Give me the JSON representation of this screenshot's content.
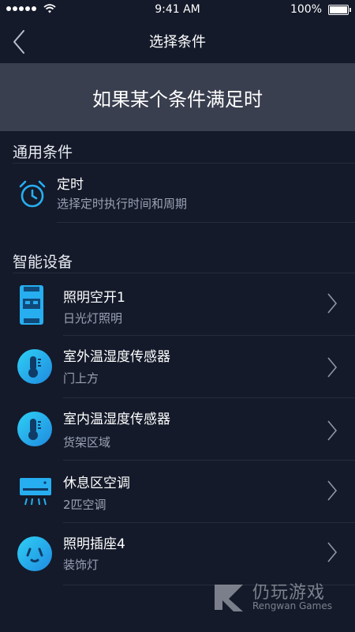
{
  "status": {
    "time": "9:41 AM",
    "battery": "100%"
  },
  "nav": {
    "title": "选择条件"
  },
  "banner": {
    "text": "如果某个条件满足时"
  },
  "general": {
    "title": "通用条件",
    "item": {
      "title": "定时",
      "subtitle": "选择定时执行时间和周期",
      "icon": "alarm-clock-icon"
    }
  },
  "devices": {
    "title": "智能设备",
    "items": [
      {
        "title": "照明空开1",
        "subtitle": "日光灯照明",
        "icon": "switch-icon"
      },
      {
        "title": "室外温湿度传感器",
        "subtitle": "门上方",
        "icon": "thermometer-icon"
      },
      {
        "title": "室内温湿度传感器",
        "subtitle": "货架区域",
        "icon": "thermometer-icon"
      },
      {
        "title": "休息区空调",
        "subtitle": "2匹空调",
        "icon": "air-conditioner-icon"
      },
      {
        "title": "照明插座4",
        "subtitle": "装饰灯",
        "icon": "socket-icon"
      }
    ]
  },
  "watermark": {
    "title": "仍玩游戏",
    "subtitle": "Rengwan Games"
  },
  "colors": {
    "background": "#141a2a",
    "banner": "#3a3f4f",
    "accent": "#27aef0",
    "muted": "#9aa2b4"
  }
}
